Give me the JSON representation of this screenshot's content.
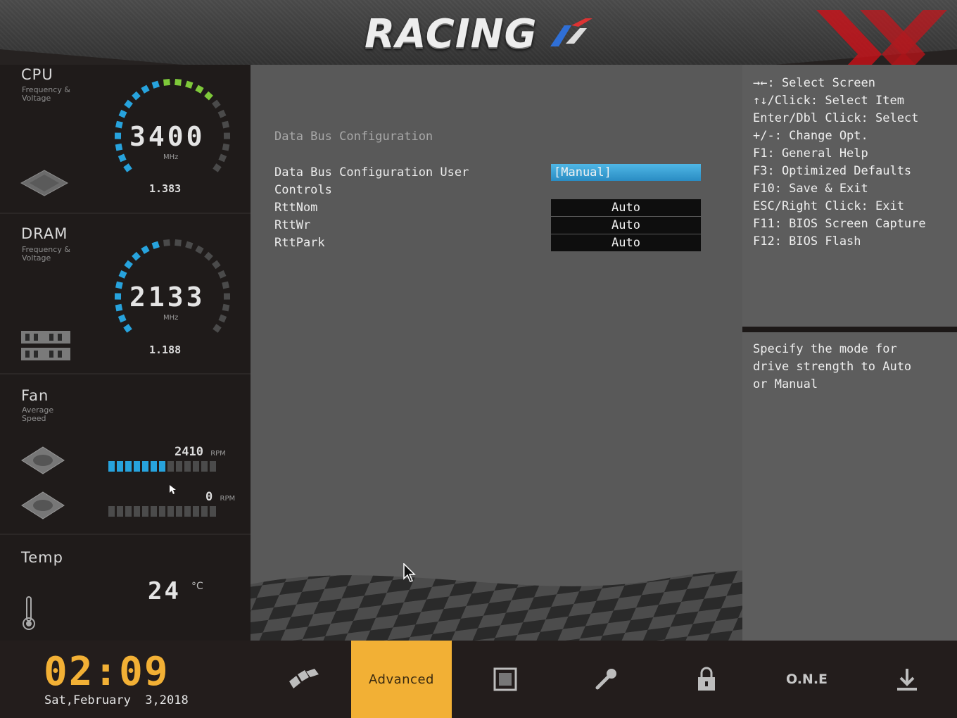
{
  "header": {
    "logo_text": "RACING"
  },
  "sidebar": {
    "cpu": {
      "title": "CPU",
      "subtitle": "Frequency & Voltage",
      "value": "3400",
      "unit": "MHz",
      "voltage": "1.383"
    },
    "dram": {
      "title": "DRAM",
      "subtitle": "Frequency & Voltage",
      "value": "2133",
      "unit": "MHz",
      "voltage": "1.188"
    },
    "fan": {
      "title": "Fan",
      "subtitle": "Average Speed",
      "fan1_rpm": "2410",
      "fan1_level": 0.5,
      "fan2_rpm": "0",
      "fan2_level": 0,
      "rpm_unit": "RPM"
    },
    "temp": {
      "title": "Temp",
      "value": "24",
      "unit": "°C"
    }
  },
  "main": {
    "section_title": "Data Bus Configuration",
    "rows": [
      {
        "label": "Data Bus Configuration User",
        "value": "[Manual]"
      },
      {
        "label": "Controls",
        "value": ""
      },
      {
        "label": "RttNom",
        "value": "Auto"
      },
      {
        "label": "RttWr",
        "value": "Auto"
      },
      {
        "label": "RttPark",
        "value": "Auto"
      }
    ]
  },
  "help": {
    "keys": [
      "→←: Select Screen",
      "↑↓/Click: Select Item",
      "Enter/Dbl Click: Select",
      "+/-: Change Opt.",
      "F1: General Help",
      "F3: Optimized Defaults",
      "F10: Save & Exit",
      "ESC/Right Click: Exit",
      "F11: BIOS Screen Capture",
      "F12: BIOS Flash"
    ],
    "description": [
      "Specify the mode for",
      "drive strength to Auto",
      "or Manual"
    ]
  },
  "footer": {
    "time": "02:09",
    "date": "Sat,February  3,2018",
    "nav": {
      "active_label": "Advanced",
      "one_label": "O.N.E"
    }
  },
  "colors": {
    "accent_orange": "#f2b035",
    "accent_blue": "#27a3dd",
    "gauge_green": "#7ec93a"
  }
}
